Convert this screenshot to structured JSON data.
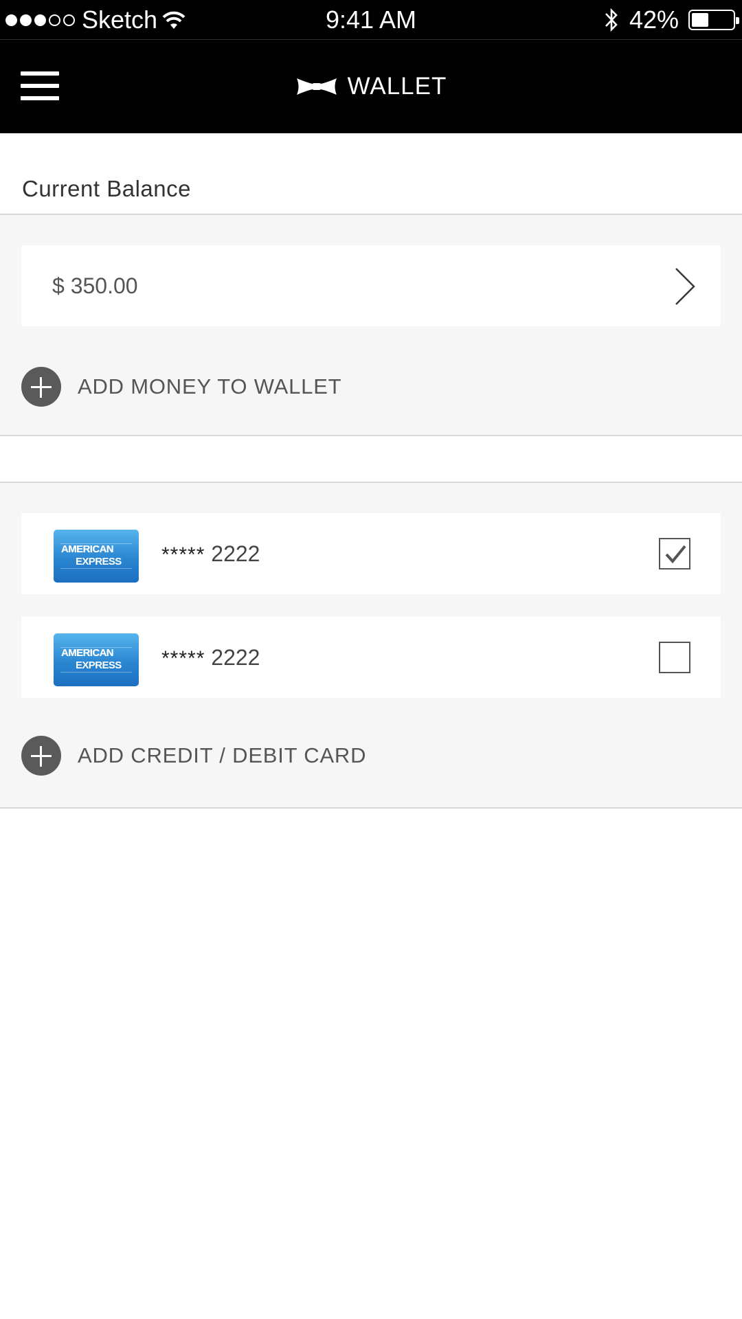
{
  "status_bar": {
    "carrier": "Sketch",
    "time": "9:41 AM",
    "battery": "42%",
    "battery_level": 0.42,
    "signal_bars": 3,
    "signal_max": 5
  },
  "nav": {
    "title": "WALLET",
    "menu_icon": "hamburger-menu-icon",
    "logo_icon": "bowtie-icon"
  },
  "balance": {
    "label": "Current Balance",
    "amount": "$ 350.00"
  },
  "add_money": {
    "label": "ADD MONEY TO WALLET"
  },
  "cards": [
    {
      "brand": "American Express",
      "logo_line1": "AMERICAN",
      "logo_line2": "EXPRESS",
      "masked": "*****",
      "last4": "2222",
      "selected": true
    },
    {
      "brand": "American Express",
      "logo_line1": "AMERICAN",
      "logo_line2": "EXPRESS",
      "masked": "*****",
      "last4": "2222",
      "selected": false
    }
  ],
  "add_card": {
    "label": "ADD CREDIT / DEBIT CARD"
  },
  "colors": {
    "header_bg": "#000000",
    "section_bg": "#f6f6f6",
    "divider": "#d6d6d6",
    "amex_blue": "#2a86d1"
  }
}
